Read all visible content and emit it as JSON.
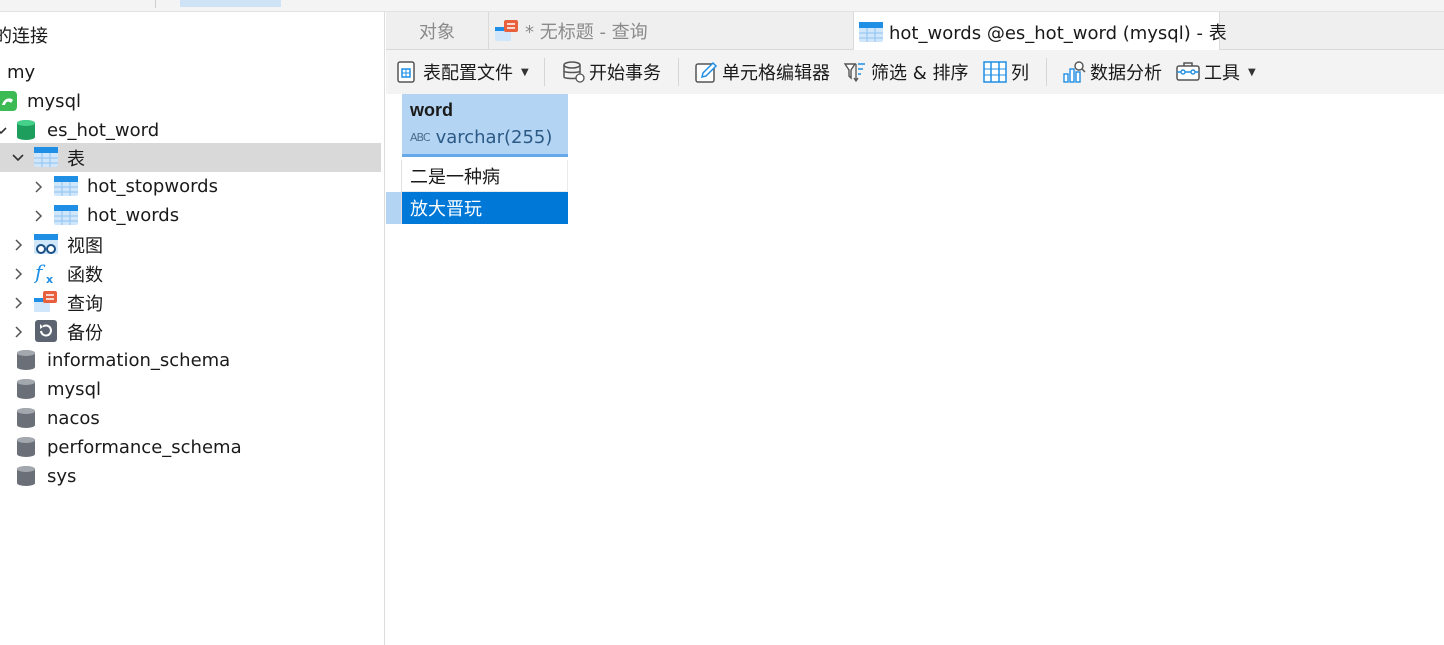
{
  "sidebar": {
    "title": "的连接",
    "items": [
      {
        "label": "my",
        "icon": "none-icon"
      },
      {
        "label": "mysql",
        "icon": "mysql-connection-icon"
      },
      {
        "label": "es_hot_word",
        "icon": "database-open-icon"
      },
      {
        "label": "表",
        "icon": "tables-folder-icon"
      },
      {
        "label": "hot_stopwords",
        "icon": "table-icon"
      },
      {
        "label": "hot_words",
        "icon": "table-icon"
      },
      {
        "label": "视图",
        "icon": "views-icon"
      },
      {
        "label": "函数",
        "icon": "functions-icon"
      },
      {
        "label": "查询",
        "icon": "queries-icon"
      },
      {
        "label": "备份",
        "icon": "backup-icon"
      },
      {
        "label": "information_schema",
        "icon": "database-icon"
      },
      {
        "label": "mysql",
        "icon": "database-icon"
      },
      {
        "label": "nacos",
        "icon": "database-icon"
      },
      {
        "label": "performance_schema",
        "icon": "database-icon"
      },
      {
        "label": "sys",
        "icon": "database-icon"
      }
    ]
  },
  "tabs": [
    {
      "label": "对象",
      "active": false
    },
    {
      "label": "* 无标题 - 查询",
      "active": false
    },
    {
      "label": "hot_words @es_hot_word (mysql) - 表",
      "active": true
    }
  ],
  "toolbar": {
    "table_profile": "表配置文件",
    "begin_transaction": "开始事务",
    "cell_editor": "单元格编辑器",
    "filter_sort": "筛选 & 排序",
    "columns": "列",
    "data_analysis": "数据分析",
    "tools": "工具"
  },
  "grid": {
    "column": {
      "name": "word",
      "type": "varchar(255)",
      "type_icon_text": "ABC"
    },
    "rows": [
      "二是一种病",
      "放大晋玩"
    ],
    "selected_row": 1
  },
  "colors": {
    "accent": "#0078d7",
    "header_bg": "#b3d4f2",
    "selected_tree": "#d9d9d9"
  }
}
